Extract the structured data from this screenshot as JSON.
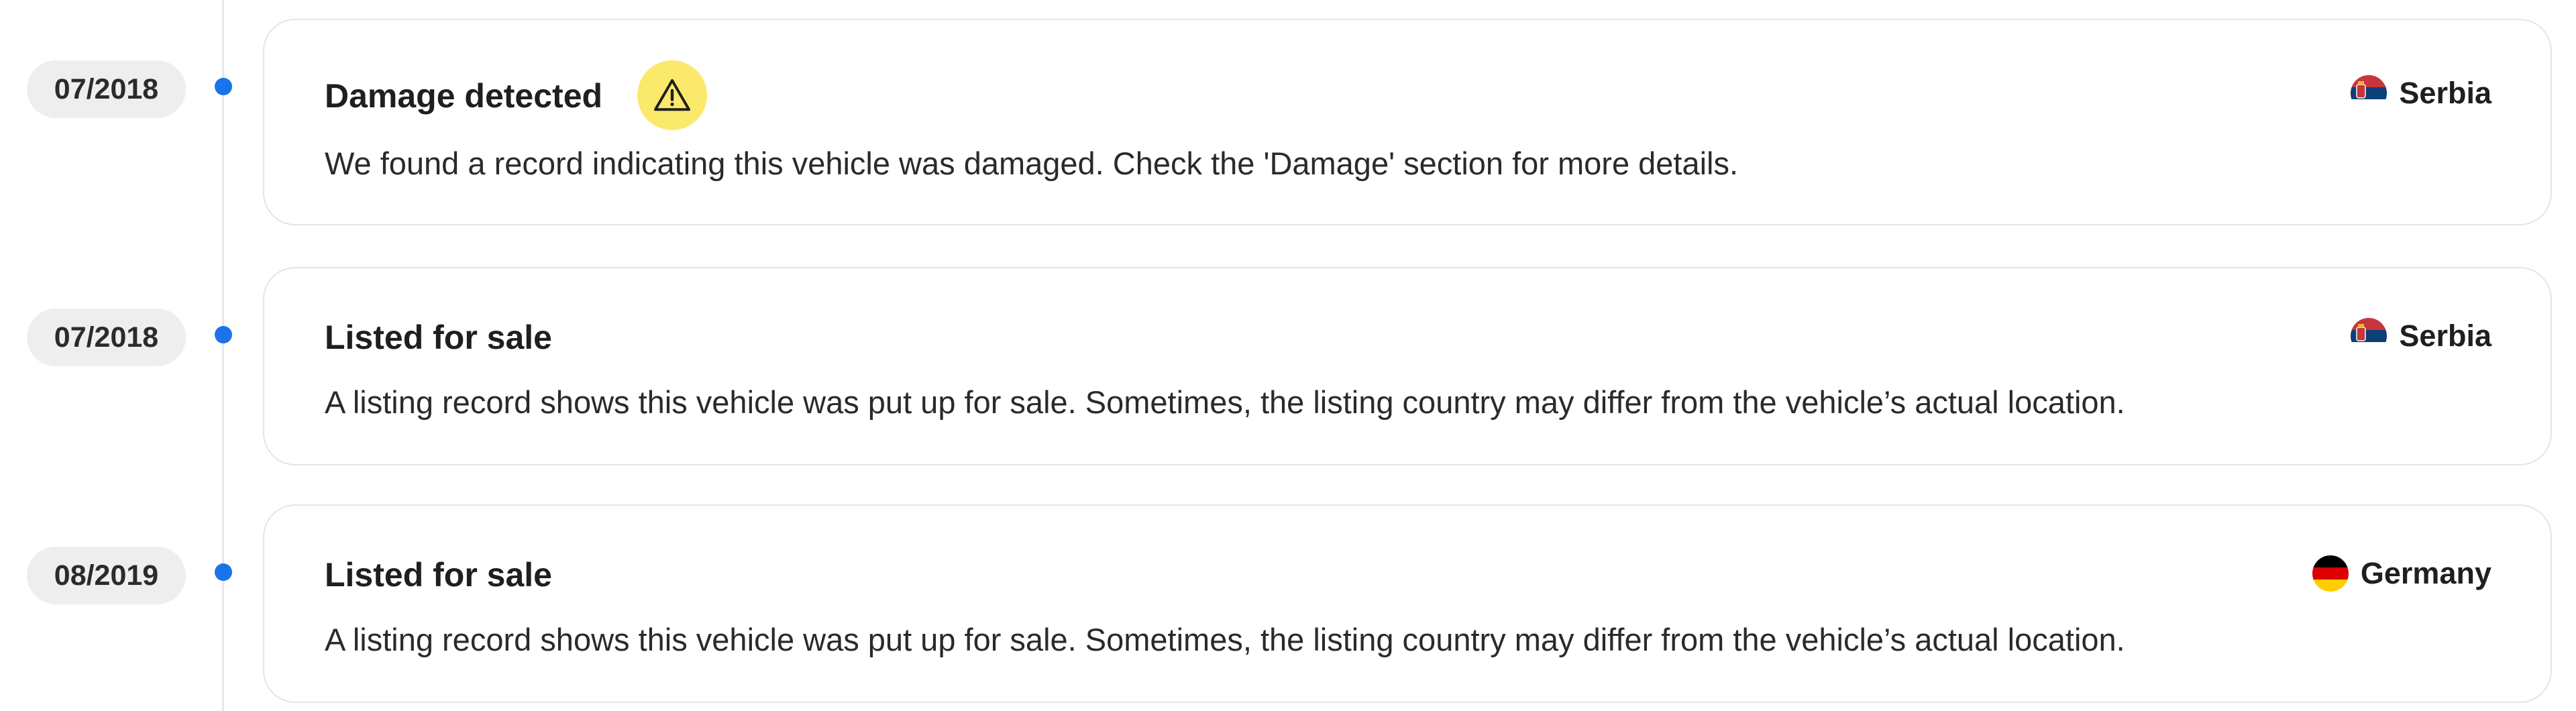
{
  "timeline": {
    "events": [
      {
        "date": "07/2018",
        "title": "Damage detected",
        "description": "We found a record indicating this vehicle was damaged. Check the 'Damage' section for more details.",
        "country": "Serbia",
        "flag_icon": "serbia-flag-icon",
        "warning_icon": "warning-triangle-icon"
      },
      {
        "date": "07/2018",
        "title": "Listed for sale",
        "description": "A listing record shows this vehicle was put up for sale. Sometimes, the listing country may differ from the vehicle’s actual location.",
        "country": "Serbia",
        "flag_icon": "serbia-flag-icon"
      },
      {
        "date": "08/2019",
        "title": "Listed for sale",
        "description": "A listing record shows this vehicle was put up for sale. Sometimes, the listing country may differ from the vehicle’s actual location.",
        "country": "Germany",
        "flag_icon": "germany-flag-icon"
      }
    ]
  },
  "colors": {
    "timeline_dot": "#1a73e8",
    "warning_badge": "#fbe96b",
    "date_pill_bg": "#eeeeee",
    "card_border": "#e3e5e9"
  }
}
